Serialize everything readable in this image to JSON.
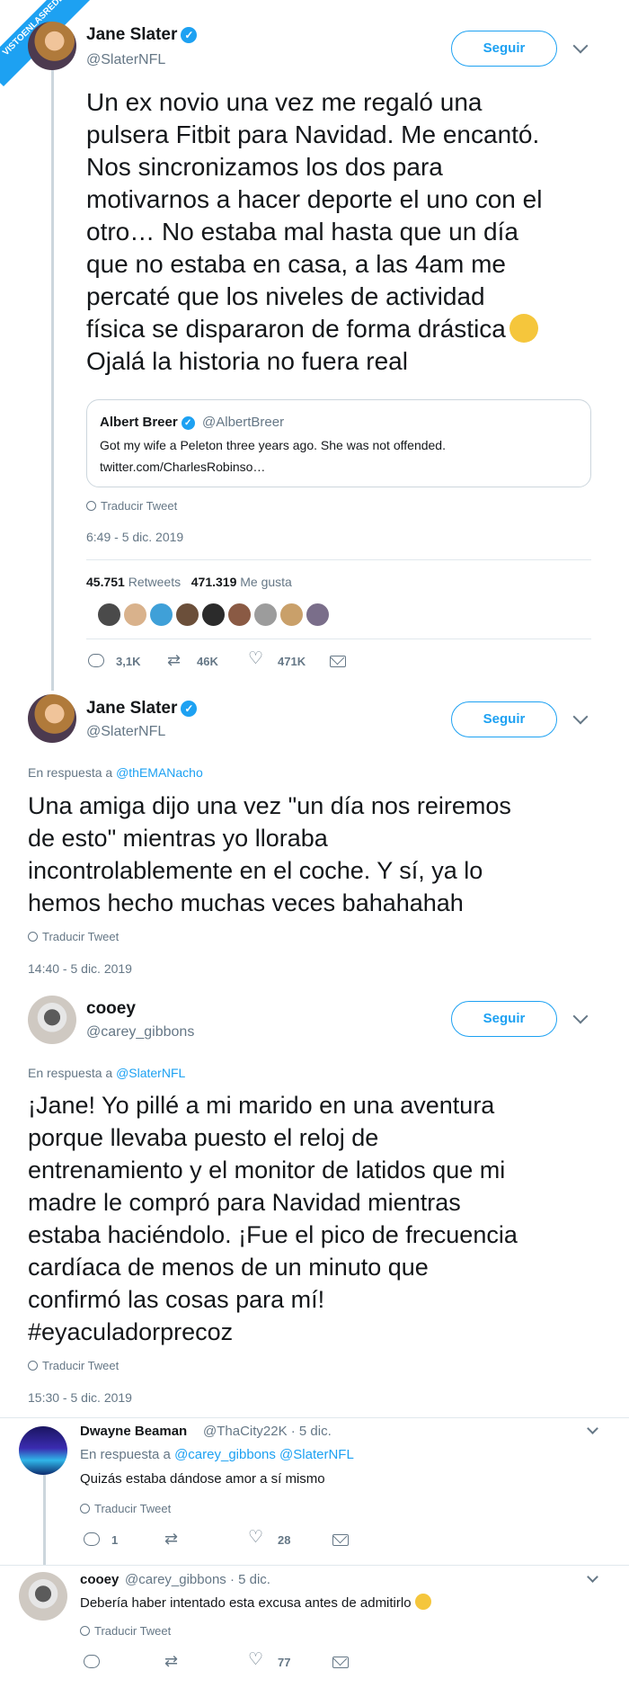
{
  "watermark": {
    "line1": "VISTOENLASREDES",
    "line2": ".com"
  },
  "follow_label": "Seguir",
  "translate_label": "Traducir Tweet",
  "tweet1": {
    "name": "Jane Slater",
    "handle": "@SlaterNFL",
    "lines": [
      "Un ex novio una vez me regaló una",
      "pulsera Fitbit para Navidad. Me encantó.",
      "Nos sincronizamos los dos para",
      "motivarnos a hacer deporte el uno con el",
      "otro… No estaba mal hasta que un día",
      "que no estaba en casa, a las 4am me",
      "percaté que los niveles de actividad",
      "física se dispararon de forma drástica",
      "Ojalá la historia no fuera real"
    ],
    "quote": {
      "name": "Albert Breer",
      "handle": "@AlbertBreer",
      "line1": "Got my wife a Peleton three years ago.  She was not offended.",
      "line2": "twitter.com/CharlesRobinso…"
    },
    "timestamp": "6:49 - 5 dic. 2019",
    "retweets_count": "45.751",
    "retweets_label": "Retweets",
    "likes_count": "471.319",
    "likes_label": "Me gusta",
    "liker_colors": [
      "#4a4a4a",
      "#d9b28c",
      "#3fa0d8",
      "#6b4f3a",
      "#2b2b2b",
      "#8a5a44",
      "#9c9c9c",
      "#c9a06a",
      "#7a6e8a"
    ],
    "actions": {
      "replies": "3,1K",
      "retweets": "46K",
      "likes": "471K"
    }
  },
  "tweet2": {
    "name": "Jane Slater",
    "handle": "@SlaterNFL",
    "reply_prefix": "En respuesta a",
    "reply_to": "@thEMANacho",
    "lines": [
      "Una amiga dijo una vez \"un día nos reiremos",
      "de esto\" mientras yo lloraba",
      "incontrolablemente en el coche. Y sí, ya lo",
      "hemos hecho muchas veces bahahahah"
    ],
    "timestamp": "14:40 - 5 dic. 2019"
  },
  "tweet3": {
    "name": "cooey",
    "handle": "@carey_gibbons",
    "reply_prefix": "En respuesta a",
    "reply_to": "@SlaterNFL",
    "lines": [
      "¡Jane! Yo pillé a mi marido en una aventura",
      "porque llevaba puesto el reloj de",
      "entrenamiento y el monitor de latidos que mi",
      "madre le compró para Navidad mientras",
      "estaba haciéndolo. ¡Fue el pico de frecuencia",
      "cardíaca de menos de un minuto que",
      "confirmó las cosas para mí!",
      "#eyaculadorprecoz"
    ],
    "timestamp": "15:30 - 5 dic. 2019"
  },
  "reply1": {
    "name": "Dwayne Beaman",
    "meta": "@ThaCity22K · 5 dic.",
    "reply_prefix": "En respuesta a",
    "reply_to": "@carey_gibbons @SlaterNFL",
    "text": "Quizás estaba dándose amor a sí mismo",
    "actions": {
      "replies": "1",
      "likes": "28"
    }
  },
  "reply2": {
    "name": "cooey",
    "meta": "@carey_gibbons · 5 dic.",
    "text": "Debería haber intentado esta excusa antes de admitirlo",
    "actions": {
      "likes": "77"
    }
  }
}
